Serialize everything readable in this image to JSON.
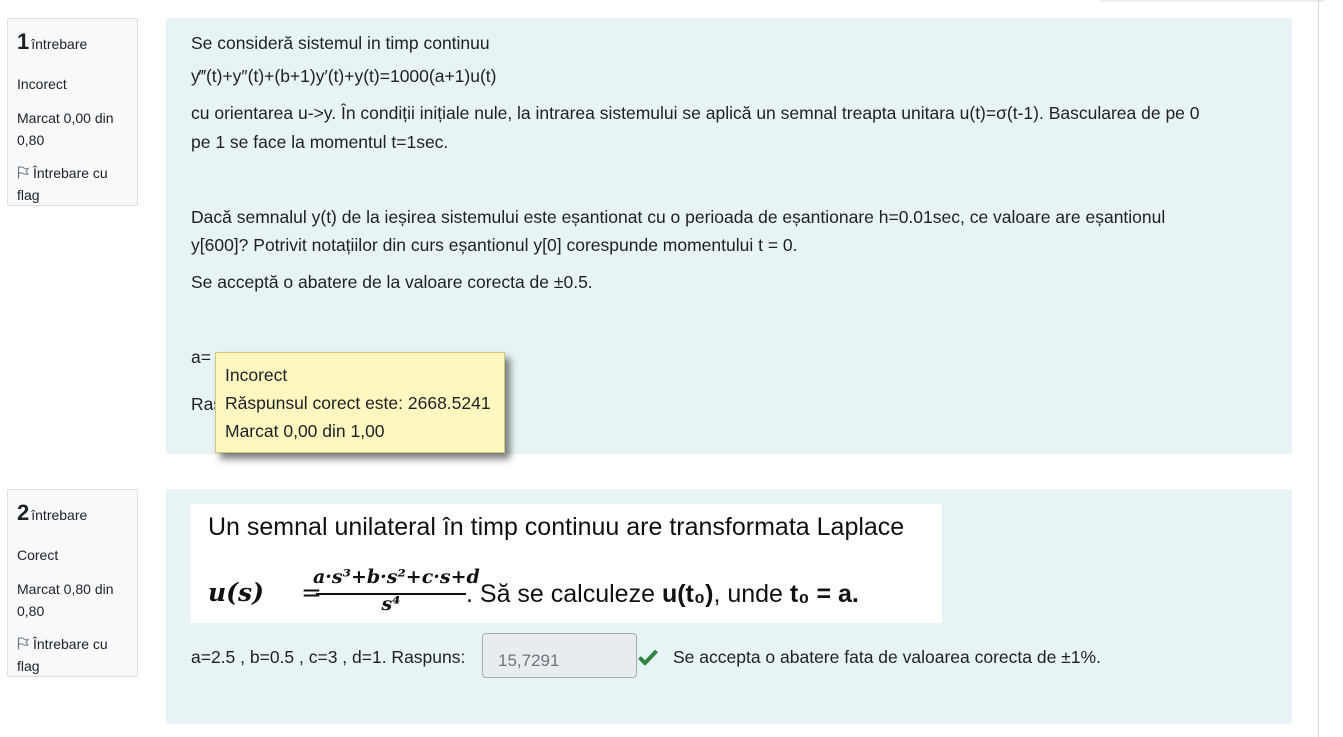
{
  "q1": {
    "number": "1",
    "qword": "întrebare",
    "state": "Incorect",
    "grade_line1": "Marcat 0,00 din",
    "grade_line2": "0,80",
    "flag_line1": "Întrebare cu",
    "flag_line2": "flag",
    "text_intro": "Se consideră sistemul in timp continuu",
    "equation": "y‴(t)+y″(t)+(b+1)y′(t)+y(t)=1000(a+1)u(t)",
    "text_line1": "cu orientarea u->y. În condiții inițiale nule, la intrarea sistemului se aplică un semnal treapta unitara u(t)=σ(t-1). Bascularea de pe 0",
    "text_line2": "pe 1 se face la momentul t=1sec.",
    "text_line3": "Dacă semnalul y(t) de la ieșirea sistemului este eșantionat cu o perioada de eșantionare h=0.01sec, ce valoare are eșantionul",
    "text_line4": "y[600]?  Potrivit notațiilor din curs eșantionul y[0] corespunde momentului t = 0.",
    "text_line5": "Se acceptă o abatere de la valoare corecta de ±0.5.",
    "partial_a": "a=",
    "partial_ras": "Ras",
    "tooltip": {
      "line1": "Incorect",
      "line2": "Răspunsul corect este: 2668.5241",
      "line3": "Marcat 0,00 din 1,00"
    }
  },
  "q2": {
    "number": "2",
    "qword": "întrebare",
    "state": "Corect",
    "grade_line1": "Marcat 0,80 din",
    "grade_line2": "0,80",
    "flag_line1": "Întrebare cu",
    "flag_line2": "flag",
    "image_title": "Un semnal unilateral în timp continuu are transformata Laplace",
    "image_formula_lhs": "u(s)",
    "image_formula_eq": "=",
    "image_formula_num": "a·s³+b·s²+c·s+d",
    "image_formula_den": "s⁴",
    "image_formula_rest_1": ". Să se calculeze ",
    "image_formula_rest_2": "u(t₀)",
    "image_formula_rest_3": ", unde ",
    "image_formula_rest_4": "t₀ = a.",
    "params_label": "a=2.5 , b=0.5 , c=3 , d=1. Raspuns:",
    "answer_value": "15,7291",
    "tolerance_text": "Se accepta o abatere fata de valoarea corecta de ±1%."
  },
  "colors": {
    "content_bg": "#e7f3f5",
    "info_bg": "#f8f9fa",
    "tooltip_bg": "#fef7c0",
    "check_green": "#2e8540"
  }
}
